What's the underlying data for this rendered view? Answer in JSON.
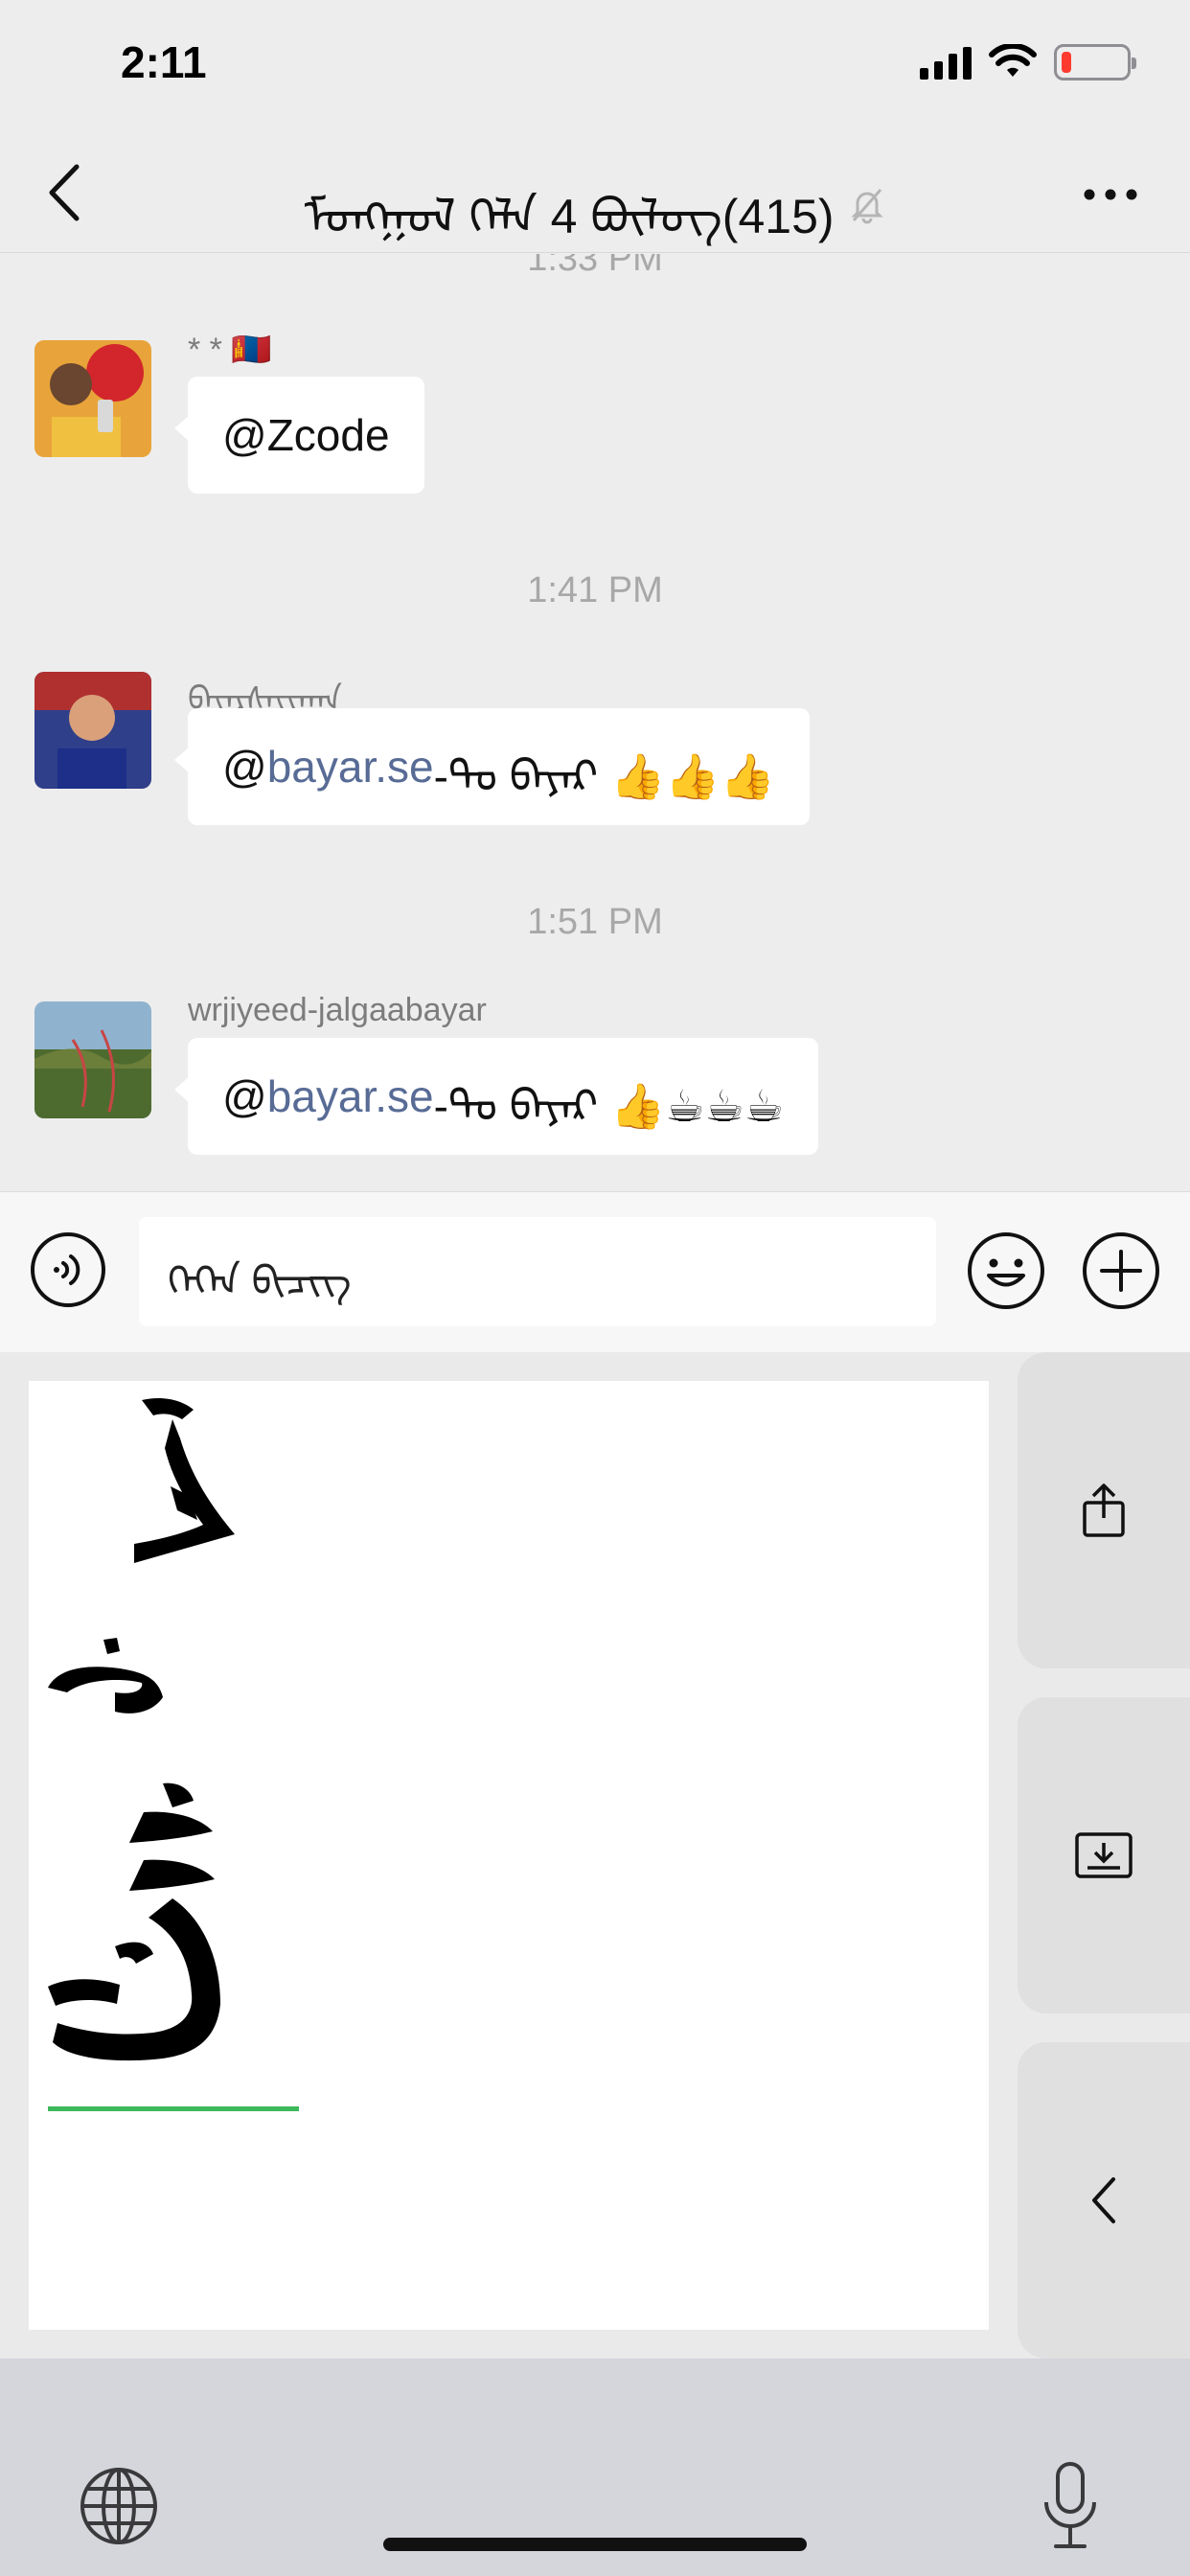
{
  "status_bar": {
    "time": "2:11",
    "battery_level": 0.15,
    "battery_color": "#ff3b30"
  },
  "nav": {
    "title": "ᠮᠣᠩᠭᠣᠯ ᠬᠡᠯᠡ 4 ᠪᠦᠯᠦᠭ(415)",
    "muted_icon": "bell-slash-icon"
  },
  "messages": [
    {
      "time": "1:33 PM",
      "sender": "* * 🇲🇳",
      "segments": [
        {
          "text": "@Zcode",
          "mention": false
        }
      ]
    },
    {
      "time": "1:41 PM",
      "sender": "ᠪᠠᠶᠠᠷᠰᠠᠶᠢᠬᠠᠨ",
      "segments": [
        {
          "text": "@",
          "mention": false
        },
        {
          "text": "bayar.se",
          "mention": true
        },
        {
          "text": "-ᠲᠤ ᠪᠠᠶᠠᠷ 👍👍👍",
          "mention": false
        }
      ]
    },
    {
      "time": "1:51 PM",
      "sender": "wrjiyeed-jalgaabayar",
      "segments": [
        {
          "text": "@",
          "mention": false
        },
        {
          "text": "bayar.se",
          "mention": true
        },
        {
          "text": "-ᠲᠤ ᠪᠠᠶᠠᠷ 👍☕☕☕",
          "mention": false
        }
      ]
    }
  ],
  "input": {
    "text": "ᠬᠡᠭᠡᠨ ᠪᠢᠴᠢᠭ"
  },
  "keyboard": {
    "side_keys": [
      "share-icon",
      "keyboard-dismiss-icon",
      "chevron-left-icon"
    ],
    "handwriting_stroke_color": "#000000",
    "underline_color": "#3cb95a"
  },
  "colors": {
    "mention": "#576b95",
    "chat_bg": "#ededed"
  }
}
